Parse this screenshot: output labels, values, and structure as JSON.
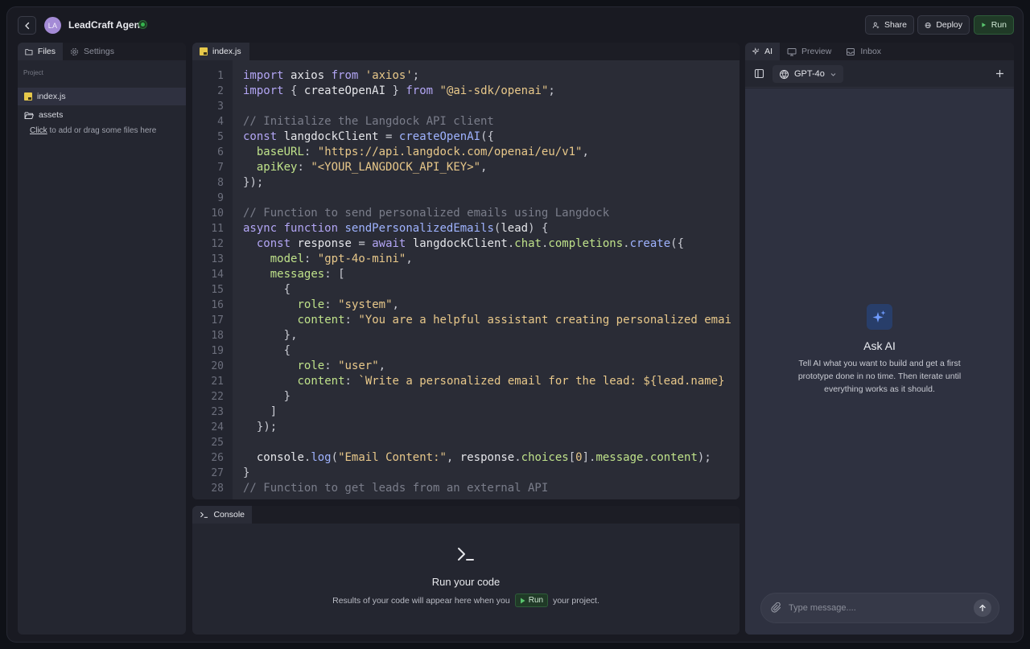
{
  "header": {
    "back_icon": "chevron-left-icon",
    "avatar_initials": "LA",
    "title": "LeadCraft Agent",
    "share_label": "Share",
    "deploy_label": "Deploy",
    "run_label": "Run"
  },
  "files_panel": {
    "tabs": [
      {
        "label": "Files"
      },
      {
        "label": "Settings"
      }
    ],
    "section_label": "Project",
    "items": [
      {
        "label": "index.js"
      },
      {
        "label": "assets"
      }
    ],
    "hint_link": "Click",
    "hint_text": " to add or drag some files here"
  },
  "editor": {
    "tab_label": "index.js",
    "lines": [
      "import axios from 'axios';",
      "import { createOpenAI } from \"@ai-sdk/openai\";",
      "",
      "// Initialize the Langdock API client",
      "const langdockClient = createOpenAI({",
      "  baseURL: \"https://api.langdock.com/openai/eu/v1\",",
      "  apiKey: \"<YOUR_LANGDOCK_API_KEY>\",",
      "});",
      "",
      "// Function to send personalized emails using Langdock",
      "async function sendPersonalizedEmails(lead) {",
      "  const response = await langdockClient.chat.completions.create({",
      "    model: \"gpt-4o-mini\",",
      "    messages: [",
      "      {",
      "        role: \"system\",",
      "        content: \"You are a helpful assistant creating personalized emai",
      "      },",
      "      {",
      "        role: \"user\",",
      "        content: `Write a personalized email for the lead: ${lead.name}",
      "      }",
      "    ]",
      "  });",
      "",
      "  console.log(\"Email Content:\", response.choices[0].message.content);",
      "}",
      "// Function to get leads from an external API"
    ]
  },
  "console": {
    "tab_label": "Console",
    "title": "Run your code",
    "sub_before": "Results of your code will appear here when you",
    "run_label": "Run",
    "sub_after": "your project."
  },
  "ai_panel": {
    "tabs": [
      {
        "label": "AI"
      },
      {
        "label": "Preview"
      },
      {
        "label": "Inbox"
      }
    ],
    "model": "GPT-4o",
    "ask_title": "Ask AI",
    "ask_desc": "Tell AI what you want to build and get a first prototype done in no time. Then iterate until everything works as it should.",
    "message_placeholder": "Type message...."
  },
  "colors": {
    "accent_run": "#203a27",
    "status_green": "#35b44e",
    "avatar": "#a48bd6"
  }
}
